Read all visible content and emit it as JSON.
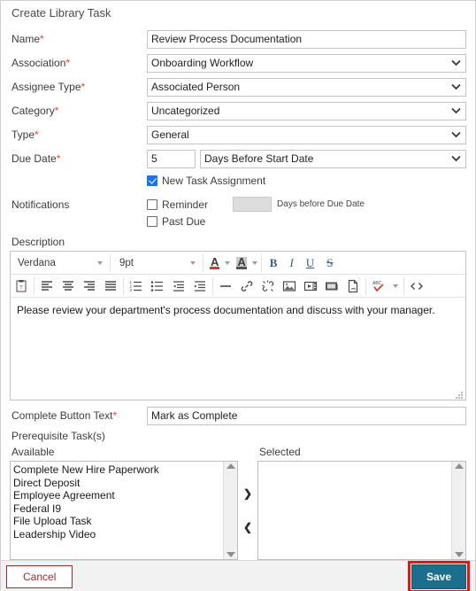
{
  "header": {
    "title": "Create Library Task",
    "accent_color": "#1f6f8b"
  },
  "form": {
    "name": {
      "label": "Name",
      "required": true,
      "value": "Review Process Documentation"
    },
    "association": {
      "label": "Association",
      "required": true,
      "value": "Onboarding Workflow"
    },
    "assignee_type": {
      "label": "Assignee Type",
      "required": true,
      "value": "Associated Person"
    },
    "category": {
      "label": "Category",
      "required": true,
      "value": "Uncategorized"
    },
    "type": {
      "label": "Type",
      "required": true,
      "value": "General"
    },
    "due_date": {
      "label": "Due Date",
      "required": true,
      "number": "5",
      "unit": "Days Before Start Date"
    },
    "new_task_assignment": {
      "label": "New Task Assignment",
      "checked": true
    },
    "notifications": {
      "label": "Notifications",
      "reminder": {
        "label": "Reminder",
        "checked": false,
        "value": "",
        "suffix": "Days before Due Date"
      },
      "past_due": {
        "label": "Past Due",
        "checked": false
      }
    }
  },
  "description": {
    "label": "Description",
    "toolbar": {
      "font_family": "Verdana",
      "font_size": "9pt",
      "text_color_icon": "text-color-icon",
      "highlight_color_icon": "highlight-color-icon",
      "bold": "B",
      "italic": "I",
      "underline": "U",
      "strikethrough": "S"
    },
    "body_text": "Please review your department's process documentation and discuss with your manager."
  },
  "complete_button_text": {
    "label": "Complete Button Text",
    "required": true,
    "value": "Mark as Complete"
  },
  "prerequisites": {
    "label": "Prerequisite Task(s)",
    "available_label": "Available",
    "selected_label": "Selected",
    "available": [
      "Complete New Hire Paperwork",
      "Direct Deposit",
      "Employee Agreement",
      "Federal I9",
      "File Upload Task",
      "Leadership Video"
    ],
    "selected": [],
    "add_button": "❯",
    "remove_button": "❮"
  },
  "footer": {
    "cancel_label": "Cancel",
    "save_label": "Save",
    "save_color": "#1b6e8c",
    "cancel_color": "#a32b2b",
    "annotation_color": "#ee1111"
  }
}
